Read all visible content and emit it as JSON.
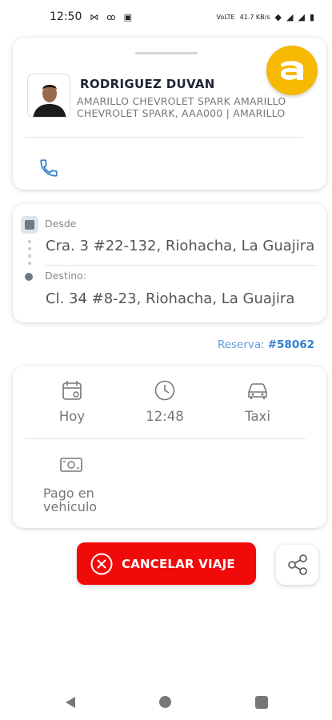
{
  "status_bar": {
    "time": "12:50",
    "network_label": "VoLTE",
    "speed": "41.7 KB/s",
    "icons": [
      "usb-icon",
      "voicemail-icon",
      "briefcase-icon",
      "wifi-icon",
      "signal-icon",
      "signal-icon",
      "battery-icon"
    ]
  },
  "driver": {
    "name": "RODRIGUEZ DUVAN",
    "vehicle_info": "AMARILLO CHEVROLET SPARK AMARILLO CHEVROLET SPARK, AAA000 | AMARILLO"
  },
  "brand": {
    "color": "#f6b800"
  },
  "route": {
    "origin_label": "Desde",
    "origin": "Cra. 3 #22-132, Riohacha, La Guajira",
    "destination_label": "Destino:",
    "destination": "Cl. 34 #8-23, Riohacha, La Guajira"
  },
  "reservation": {
    "label": "Reserva:",
    "number": "#58062"
  },
  "trip": {
    "date": "Hoy",
    "time": "12:48",
    "service": "Taxi",
    "payment": "Pago en vehiculo"
  },
  "actions": {
    "cancel_label": "CANCELAR VIAJE",
    "cancel_color": "#f10a0a"
  }
}
